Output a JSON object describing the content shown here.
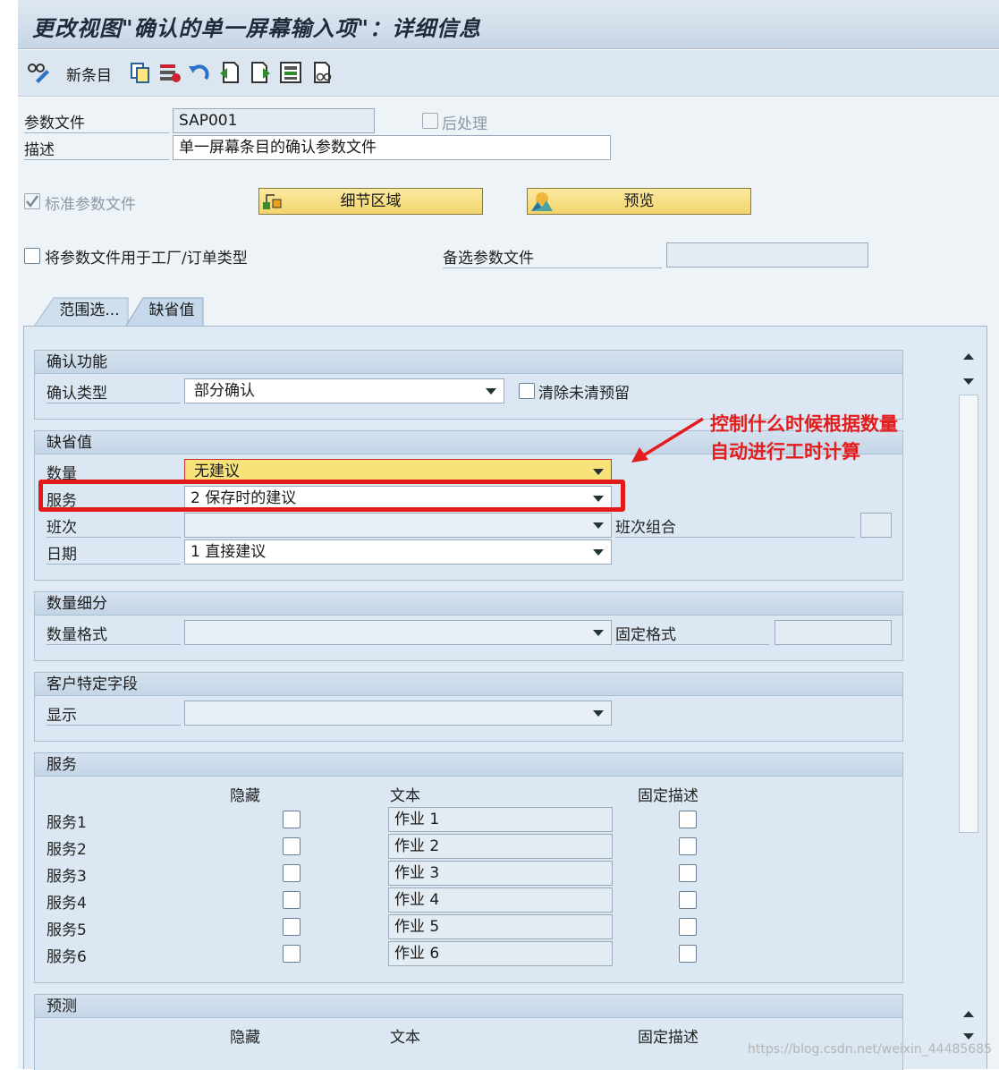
{
  "title": "更改视图\"确认的单一屏幕输入项\"：详细信息",
  "toolbar": {
    "new_entry": "新条目"
  },
  "header": {
    "profile_label": "参数文件",
    "profile_value": "SAP001",
    "postprocess_label": "后处理",
    "desc_label": "描述",
    "desc_value": "单一屏幕条目的确认参数文件",
    "std_profile_label": "标准参数文件",
    "detail_btn": "细节区域",
    "preview_btn": "预览",
    "plant_label": "将参数文件用于工厂/订单类型",
    "alt_label": "备选参数文件",
    "alt_value": ""
  },
  "tabs": [
    {
      "label": "范围选..."
    },
    {
      "label": "缺省值"
    }
  ],
  "confirm_group": {
    "title": "确认功能",
    "type_label": "确认类型",
    "type_value": "部分确认",
    "clear_label": "清除未清预留"
  },
  "defaults_group": {
    "title": "缺省值",
    "qty_label": "数量",
    "qty_value": "无建议",
    "service_label": "服务",
    "service_value": "2 保存时的建议",
    "shift_label": "班次",
    "shift_value": "",
    "shift_combo_label": "班次组合",
    "date_label": "日期",
    "date_value": "1 直接建议"
  },
  "qty_group": {
    "title": "数量细分",
    "format_label": "数量格式",
    "fixed_label": "固定格式"
  },
  "customer_group": {
    "title": "客户特定字段",
    "display_label": "显示"
  },
  "service_group": {
    "title": "服务",
    "col_hide": "隐藏",
    "col_text": "文本",
    "col_fixed": "固定描述",
    "rows": [
      {
        "label": "服务1",
        "text": "作业 1"
      },
      {
        "label": "服务2",
        "text": "作业 2"
      },
      {
        "label": "服务3",
        "text": "作业 3"
      },
      {
        "label": "服务4",
        "text": "作业 4"
      },
      {
        "label": "服务5",
        "text": "作业 5"
      },
      {
        "label": "服务6",
        "text": "作业 6"
      }
    ]
  },
  "forecast_group": {
    "title": "预测",
    "col_hide": "隐藏",
    "col_text": "文本",
    "col_fixed": "固定描述"
  },
  "annotation": {
    "line1": "控制什么时候根据数量",
    "line2": "自动进行工时计算",
    "color": "#e31d1d"
  },
  "watermark": "https://blog.csdn.net/weixin_44485685"
}
